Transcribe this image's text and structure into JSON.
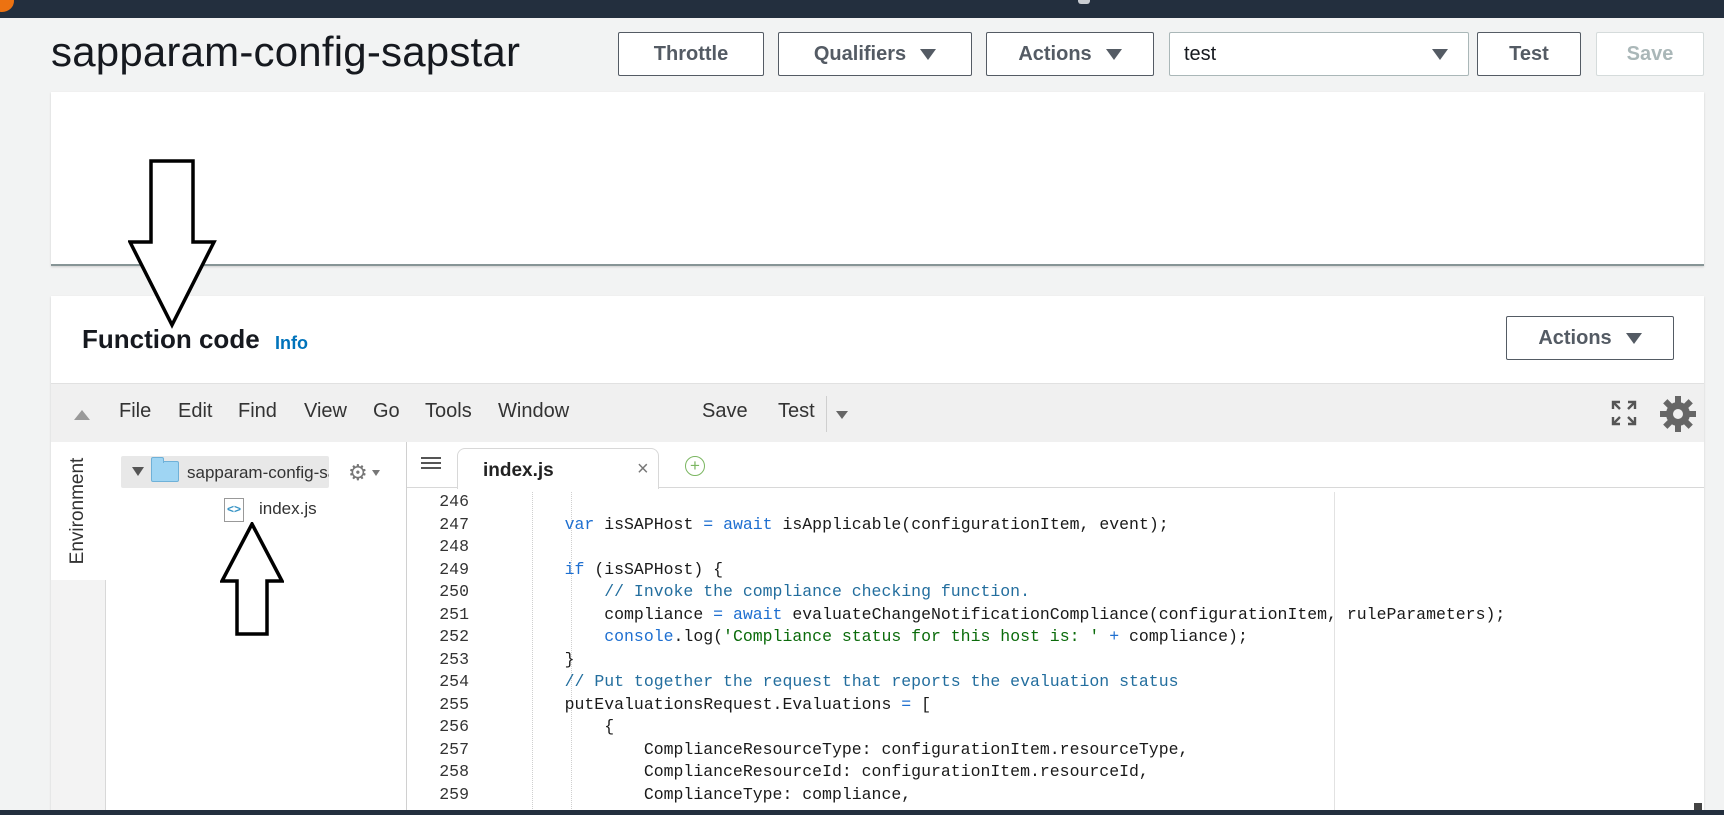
{
  "header": {
    "function_name": "sapparam-config-sapstar",
    "buttons": {
      "throttle": "Throttle",
      "qualifiers": "Qualifiers",
      "actions": "Actions",
      "test": "Test",
      "save": "Save"
    },
    "test_event_select": "test"
  },
  "function_code": {
    "title": "Function code",
    "info_link": "Info",
    "actions_button": "Actions"
  },
  "ide": {
    "menu": [
      "File",
      "Edit",
      "Find",
      "View",
      "Go",
      "Tools",
      "Window"
    ],
    "save": "Save",
    "test": "Test",
    "environment_tab": "Environment",
    "tree": {
      "root": "sapparam-config-sapstar",
      "file": "index.js",
      "file_icon_glyph": "<>"
    },
    "tab": {
      "label": "index.js",
      "close_glyph": "×",
      "add_glyph": "+"
    },
    "code_lines": [
      {
        "n": "246",
        "text": ""
      },
      {
        "n": "247",
        "text": "    var isSAPHost = await isApplicable(configurationItem, event);"
      },
      {
        "n": "248",
        "text": ""
      },
      {
        "n": "249",
        "text": "    if (isSAPHost) {"
      },
      {
        "n": "250",
        "text": "        // Invoke the compliance checking function."
      },
      {
        "n": "251",
        "text": "        compliance = await evaluateChangeNotificationCompliance(configurationItem, ruleParameters);"
      },
      {
        "n": "252",
        "text": "        console.log('Compliance status for this host is: ' + compliance);"
      },
      {
        "n": "253",
        "text": "    }"
      },
      {
        "n": "254",
        "text": "    // Put together the request that reports the evaluation status"
      },
      {
        "n": "255",
        "text": "    putEvaluationsRequest.Evaluations = ["
      },
      {
        "n": "256",
        "text": "        {"
      },
      {
        "n": "257",
        "text": "            ComplianceResourceType: configurationItem.resourceType,"
      },
      {
        "n": "258",
        "text": "            ComplianceResourceId: configurationItem.resourceId,"
      },
      {
        "n": "259",
        "text": "            ComplianceType: compliance,"
      }
    ]
  },
  "colors": {
    "aws_nav": "#232f3e",
    "link_blue": "#0073bb",
    "code_keyword": "#1e6fd0",
    "code_comment": "#236e9e",
    "code_string": "#0b6b0b"
  }
}
